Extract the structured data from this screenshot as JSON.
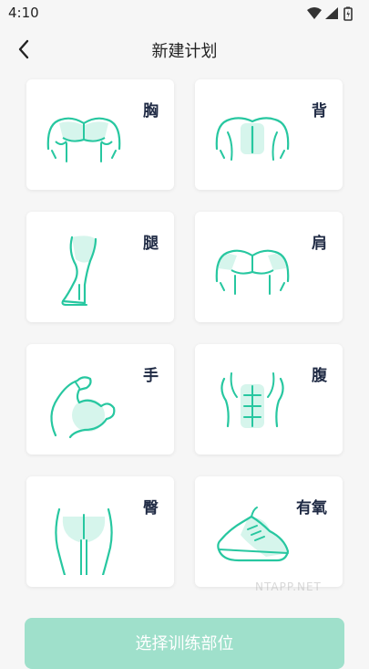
{
  "status_bar": {
    "time": "4:10"
  },
  "nav": {
    "title": "新建计划"
  },
  "body_parts": [
    {
      "label": "胸",
      "icon": "chest-icon"
    },
    {
      "label": "背",
      "icon": "back-icon"
    },
    {
      "label": "腿",
      "icon": "leg-icon"
    },
    {
      "label": "肩",
      "icon": "shoulder-icon"
    },
    {
      "label": "手",
      "icon": "arm-icon"
    },
    {
      "label": "腹",
      "icon": "abs-icon"
    },
    {
      "label": "臀",
      "icon": "glute-icon"
    },
    {
      "label": "有氧",
      "icon": "sneaker-icon"
    }
  ],
  "watermark": "NTAPP.NET",
  "actions": {
    "select_label": "选择训练部位"
  },
  "colors": {
    "accent": "#27c7a0",
    "accent_fill": "#d6f5ec",
    "button": "#9fe0cb"
  }
}
